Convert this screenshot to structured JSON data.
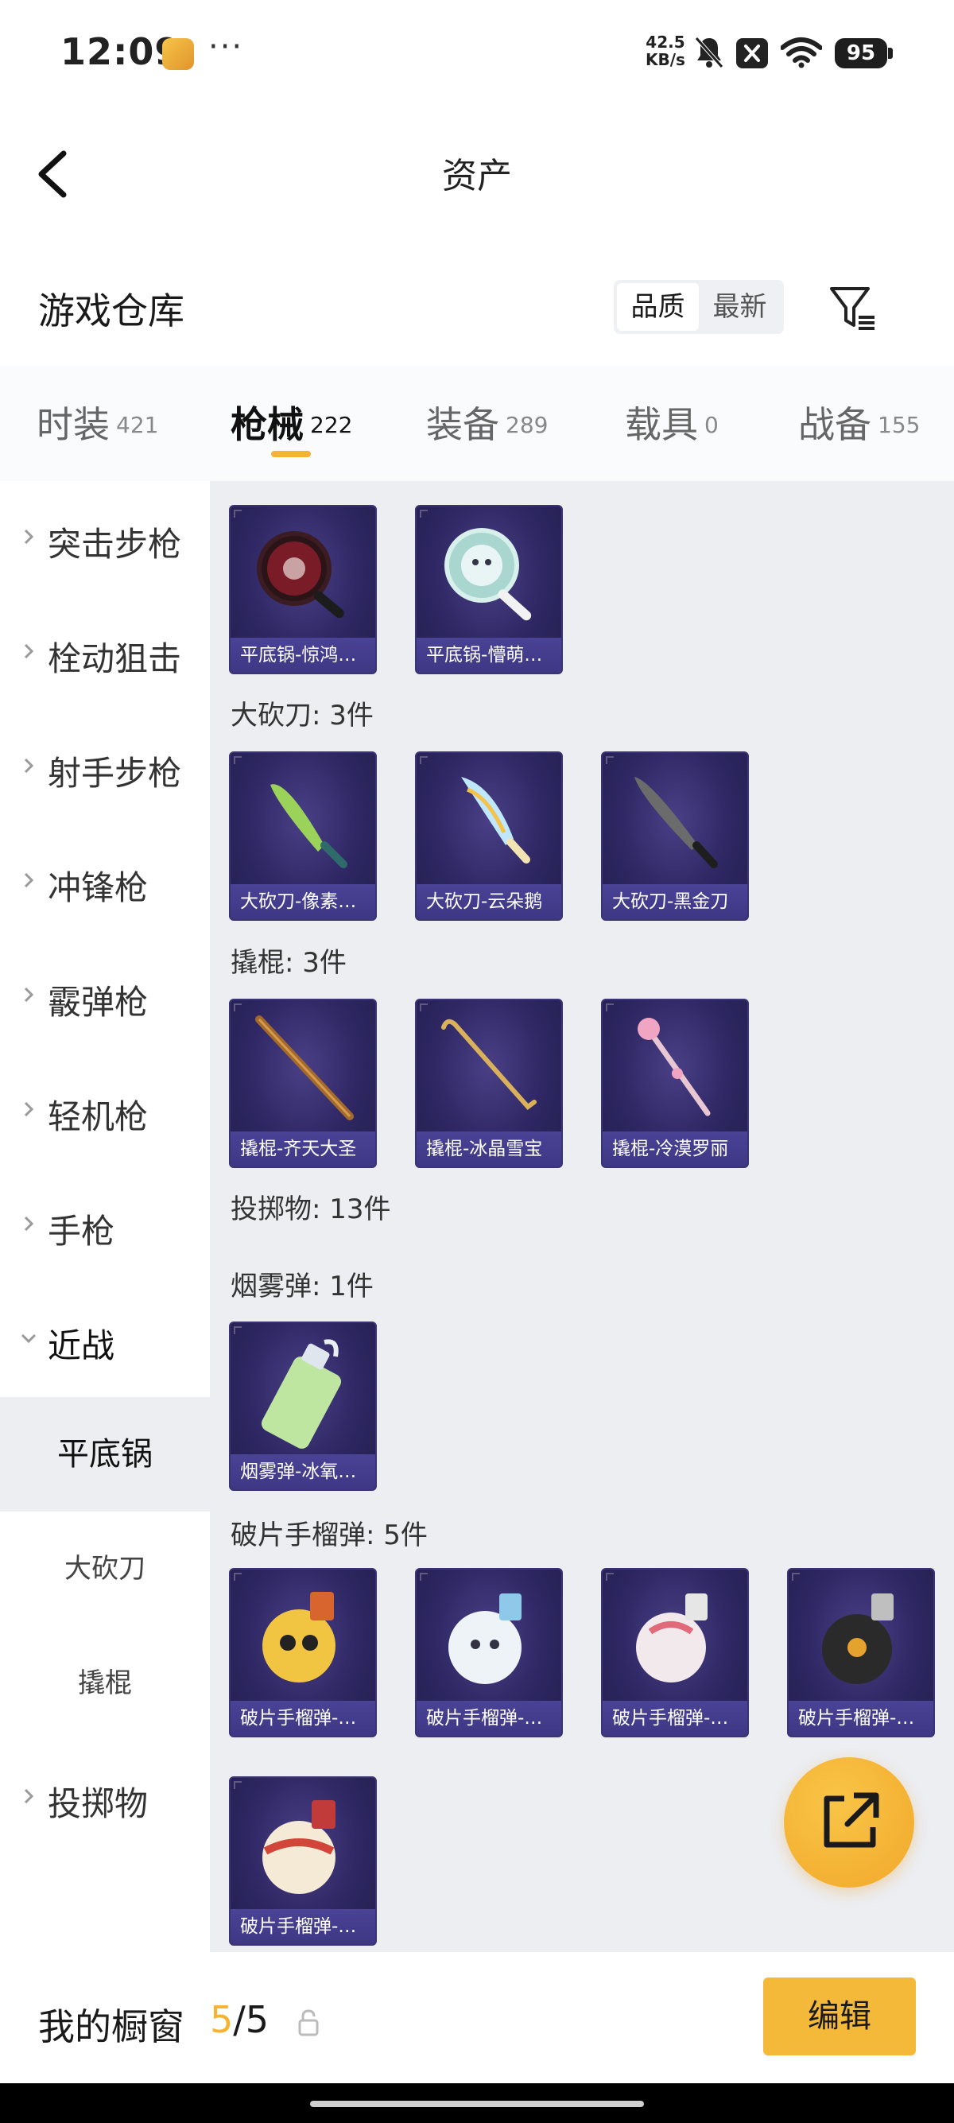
{
  "status_bar": {
    "time": "12:09",
    "dots": "···",
    "net_speed_value": "42.5",
    "net_speed_unit": "KB/s",
    "battery": "95",
    "icons": [
      "bell-muted-icon",
      "x-notification-icon",
      "wifi-icon",
      "battery-icon"
    ]
  },
  "header": {
    "title": "资产",
    "back_icon": "chevron-left-icon"
  },
  "warehouse": {
    "title": "游戏仓库",
    "sort_options": [
      "品质",
      "最新"
    ],
    "sort_selected": "品质",
    "filter_icon": "filter-icon"
  },
  "tabs": [
    {
      "label": "时装",
      "count": "421"
    },
    {
      "label": "枪械",
      "count": "222",
      "active": true
    },
    {
      "label": "装备",
      "count": "289"
    },
    {
      "label": "载具",
      "count": "0"
    },
    {
      "label": "战备",
      "count": "155"
    }
  ],
  "sidebar": {
    "items": [
      {
        "label": "突击步枪"
      },
      {
        "label": "栓动狙击"
      },
      {
        "label": "射手步枪"
      },
      {
        "label": "冲锋枪"
      },
      {
        "label": "霰弹枪"
      },
      {
        "label": "轻机枪"
      },
      {
        "label": "手枪"
      },
      {
        "label": "近战",
        "expanded": true
      },
      {
        "label": "投掷物"
      }
    ],
    "sub_items": [
      {
        "label": "平底锅",
        "active": true
      },
      {
        "label": "大砍刀"
      },
      {
        "label": "撬棍"
      }
    ]
  },
  "sections": {
    "pan": {
      "items": [
        "平底锅-惊鸿…",
        "平底锅-懵萌…"
      ]
    },
    "machete": {
      "title": "大砍刀: 3件",
      "items": [
        "大砍刀-像素…",
        "大砍刀-云朵鹅",
        "大砍刀-黑金刀"
      ]
    },
    "crowbar": {
      "title": "撬棍: 3件",
      "items": [
        "撬棍-齐天大圣",
        "撬棍-冰晶雪宝",
        "撬棍-冷漠罗丽"
      ]
    },
    "throwables_title": "投掷物: 13件",
    "smoke": {
      "title": "烟雾弹: 1件",
      "items": [
        "烟雾弹-冰氧…"
      ]
    },
    "frag": {
      "title": "破片手榴弹: 5件",
      "items": [
        "破片手榴弹-…",
        "破片手榴弹-…",
        "破片手榴弹-…",
        "破片手榴弹-…",
        "破片手榴弹-…"
      ]
    }
  },
  "share_icon": "share-external-icon",
  "bottom_bar": {
    "label": "我的橱窗",
    "count_current": "5",
    "count_total": "/5",
    "lock_icon": "lock-icon",
    "edit_label": "编辑"
  }
}
